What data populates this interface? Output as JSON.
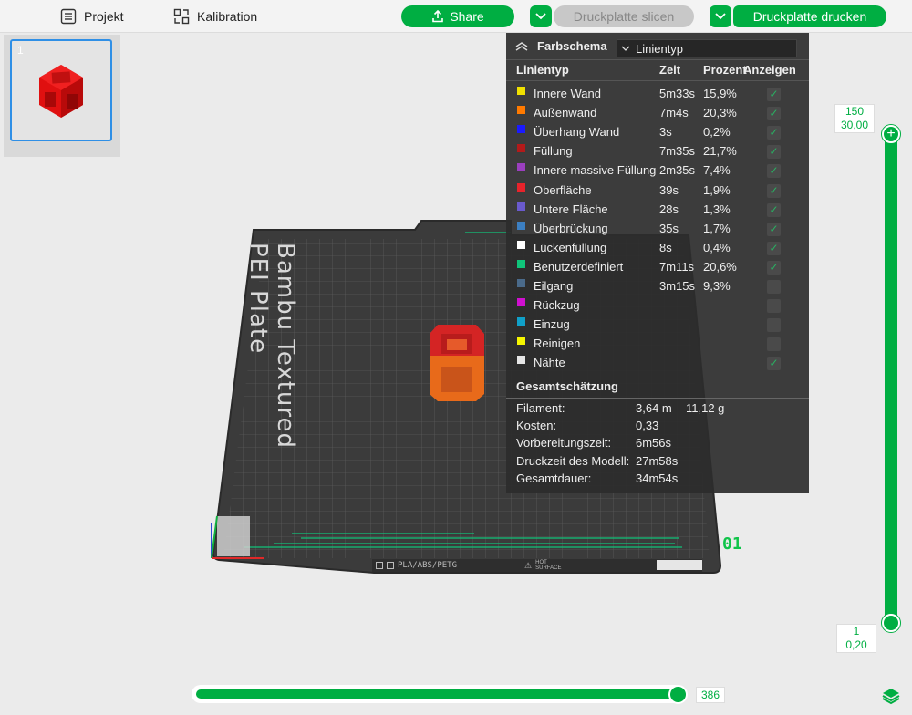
{
  "toolbar": {
    "project_label": "Projekt",
    "calibration_label": "Kalibration",
    "share_label": "Share",
    "slice_label": "Druckplatte slicen",
    "print_label": "Druckplatte drucken"
  },
  "thumbnail": {
    "plate_number": "1"
  },
  "plate": {
    "name": "Bambu Textured PEI Plate",
    "plate_id": "01",
    "filament_types": "PLA/ABS/PETG",
    "hot_label": "HOT",
    "surface_label": "SURFACE"
  },
  "legend": {
    "title": "Farbschema",
    "scheme_value": "Linientyp",
    "columns": {
      "type": "Linientyp",
      "time": "Zeit",
      "percent": "Prozent",
      "show": "Anzeigen"
    },
    "rows": [
      {
        "name": "Innere Wand",
        "time": "5m33s",
        "percent": "15,9%",
        "color": "#f0e000",
        "shown": true
      },
      {
        "name": "Außenwand",
        "time": "7m4s",
        "percent": "20,3%",
        "color": "#ff7a00",
        "shown": true
      },
      {
        "name": "Überhang Wand",
        "time": "3s",
        "percent": "0,2%",
        "color": "#1a1aff",
        "shown": true
      },
      {
        "name": "Füllung",
        "time": "7m35s",
        "percent": "21,7%",
        "color": "#b31a1a",
        "shown": true
      },
      {
        "name": "Innere massive Füllung",
        "time": "2m35s",
        "percent": "7,4%",
        "color": "#9b3fbf",
        "shown": true
      },
      {
        "name": "Oberfläche",
        "time": "39s",
        "percent": "1,9%",
        "color": "#e8232b",
        "shown": true
      },
      {
        "name": "Untere Fläche",
        "time": "28s",
        "percent": "1,3%",
        "color": "#6a5acd",
        "shown": true
      },
      {
        "name": "Überbrückung",
        "time": "35s",
        "percent": "1,7%",
        "color": "#3c7fc2",
        "shown": true
      },
      {
        "name": "Lückenfüllung",
        "time": "8s",
        "percent": "0,4%",
        "color": "#ffffff",
        "shown": true
      },
      {
        "name": "Benutzerdefiniert",
        "time": "7m11s",
        "percent": "20,6%",
        "color": "#10c47a",
        "shown": true
      },
      {
        "name": "Eilgang",
        "time": "3m15s",
        "percent": "9,3%",
        "color": "#4a6a8a",
        "shown": false
      },
      {
        "name": "Rückzug",
        "time": "",
        "percent": "",
        "color": "#d010d0",
        "shown": false
      },
      {
        "name": "Einzug",
        "time": "",
        "percent": "",
        "color": "#10a0c8",
        "shown": false
      },
      {
        "name": "Reinigen",
        "time": "",
        "percent": "",
        "color": "#f5f500",
        "shown": false
      },
      {
        "name": "Nähte",
        "time": "",
        "percent": "",
        "color": "#e6e6e6",
        "shown": true
      }
    ],
    "totals_title": "Gesamtschätzung",
    "stats": [
      {
        "label": "Filament:",
        "value": "3,64 m",
        "extra": "11,12 g"
      },
      {
        "label": "Kosten:",
        "value": "0,33",
        "extra": ""
      },
      {
        "label": "Vorbereitungszeit:",
        "value": "6m56s",
        "extra": ""
      },
      {
        "label": "Druckzeit des Modell:",
        "value": "27m58s",
        "extra": ""
      },
      {
        "label": "Gesamtdauer:",
        "value": "34m54s",
        "extra": ""
      }
    ]
  },
  "layer_slider": {
    "top_layer": "150",
    "top_height": "30,00",
    "bottom_layer": "1",
    "bottom_height": "0,20"
  },
  "move_slider": {
    "value": "386"
  },
  "colors": {
    "accent": "#00ae42",
    "panel": "#2c2c2c",
    "selection": "#2f8fe6"
  }
}
